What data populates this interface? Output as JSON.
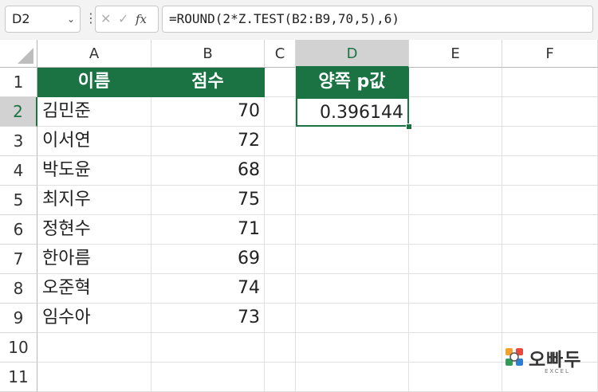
{
  "formula_bar": {
    "name_box": "D2",
    "name_box_chevron": "⌄",
    "dots": "⋮",
    "cancel_icon": "✕",
    "enter_icon": "✓",
    "fx_label": "fx",
    "formula": "=ROUND(2*Z.TEST(B2:B9,70,5),6)"
  },
  "columns": [
    "A",
    "B",
    "C",
    "D",
    "E",
    "F"
  ],
  "selected_column": "D",
  "rows": [
    "1",
    "2",
    "3",
    "4",
    "5",
    "6",
    "7",
    "8",
    "9",
    "10",
    "11"
  ],
  "selected_row": "2",
  "headers": {
    "name": "이름",
    "score": "점수",
    "pvalue": "양쪽 p값"
  },
  "data": [
    {
      "name": "김민준",
      "score": "70"
    },
    {
      "name": "이서연",
      "score": "72"
    },
    {
      "name": "박도윤",
      "score": "68"
    },
    {
      "name": "최지우",
      "score": "75"
    },
    {
      "name": "정현수",
      "score": "71"
    },
    {
      "name": "한아름",
      "score": "69"
    },
    {
      "name": "오준혁",
      "score": "74"
    },
    {
      "name": "임수아",
      "score": "73"
    }
  ],
  "result": "0.396144",
  "logo": {
    "text": "오빠두",
    "sub": "EXCEL"
  },
  "colors": {
    "accent": "#1b7344",
    "header_fill": "#1b7344",
    "selected_header": "#d2d2d2"
  }
}
